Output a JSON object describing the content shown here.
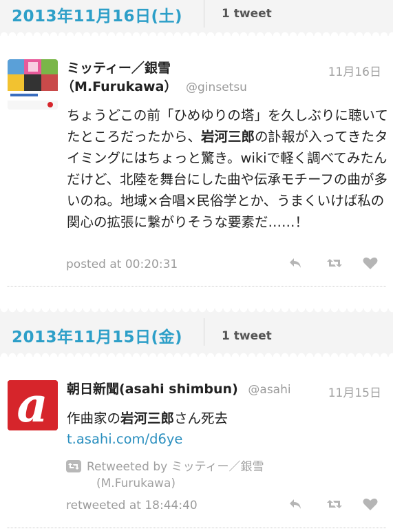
{
  "days": [
    {
      "date": "2013年11月16日(土)",
      "count": "1 tweet"
    },
    {
      "date": "2013年11月15日(金)",
      "count": "1 tweet"
    }
  ],
  "tweet1": {
    "name_line1": "ミッティー／銀雪",
    "name_line2": "（M.Furukawa）",
    "handle": "@ginsetsu",
    "date": "11月16日",
    "text_a": "ちょうどこの前「ひめゆりの塔」を久しぶりに聴いてたところだったから、",
    "text_bold": "岩河三郎",
    "text_b": "の訃報が入ってきたタイミングにはちょっと驚き。wikiで軽く調べてみたんだけど、北陸を舞台にした曲や伝承モチーフの曲が多いのね。地域×合唱×民俗学とか、うまくいけば私の関心の拡張に繋がりそうな要素だ……！",
    "posted": "posted at 00:20:31"
  },
  "tweet2": {
    "name": "朝日新聞(asahi shimbun)",
    "handle": "@asahi",
    "date": "11月15日",
    "text_a": "作曲家の",
    "text_bold": "岩河三郎",
    "text_b": "さん死去",
    "link": "t.asahi.com/d6ye",
    "retweeted_by": "Retweeted by ミッティー／銀雪",
    "retweeted_by_2": "(M.Furukawa)",
    "posted": "retweeted at 18:44:40",
    "avatar_letter": "a"
  },
  "colors": {
    "accent": "#2d9fc8",
    "asahi_red": "#d6252b",
    "link": "#2a8fbf"
  }
}
